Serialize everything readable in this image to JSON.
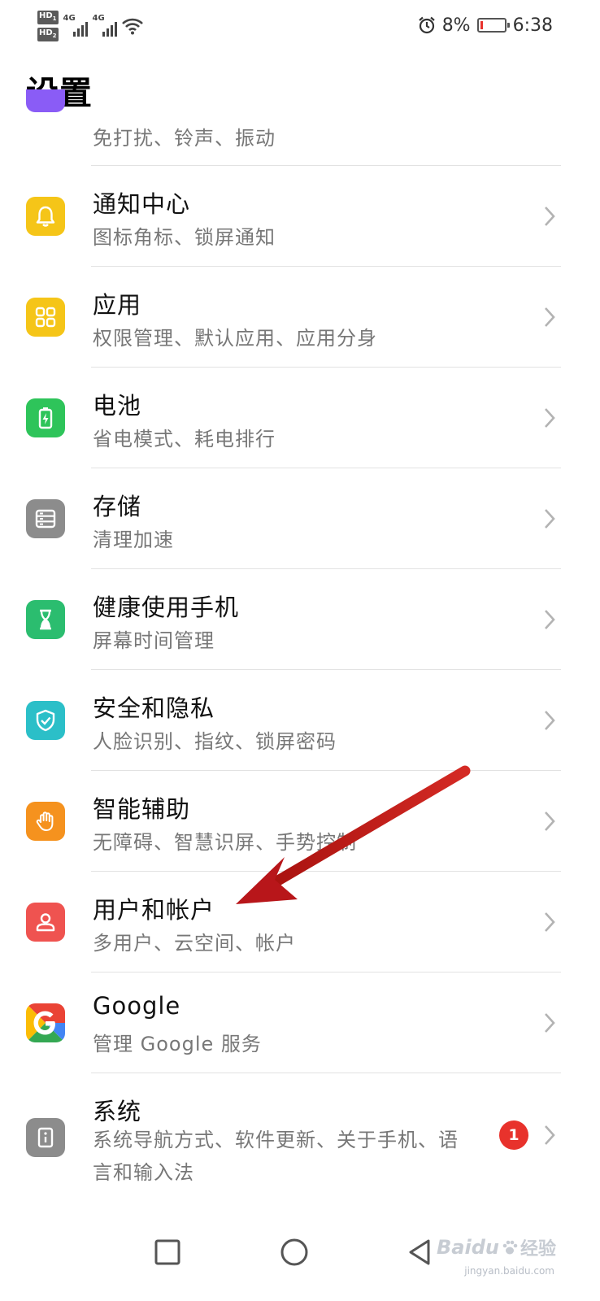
{
  "status_bar": {
    "sim1_tag": "HD",
    "sim1_sub": "1",
    "sim2_tag": "HD",
    "sim2_sub": "2",
    "network1": "4G",
    "network2": "4G",
    "battery_percent": "8%",
    "battery_level": 0.08,
    "time": "6:38",
    "battery_color": "#e8322c"
  },
  "page": {
    "title": "设置"
  },
  "settings": [
    {
      "title": "",
      "subtitle": "免打扰、铃声、振动",
      "icon": "sound-icon",
      "color": "#8a5cf6"
    },
    {
      "title": "通知中心",
      "subtitle": "图标角标、锁屏通知",
      "icon": "bell-icon",
      "color": "#f5c518"
    },
    {
      "title": "应用",
      "subtitle": "权限管理、默认应用、应用分身",
      "icon": "apps-grid-icon",
      "color": "#f5c518"
    },
    {
      "title": "电池",
      "subtitle": "省电模式、耗电排行",
      "icon": "battery-icon",
      "color": "#2ec45a"
    },
    {
      "title": "存储",
      "subtitle": "清理加速",
      "icon": "storage-icon",
      "color": "#8c8c8c"
    },
    {
      "title": "健康使用手机",
      "subtitle": "屏幕时间管理",
      "icon": "hourglass-icon",
      "color": "#2bbd6f"
    },
    {
      "title": "安全和隐私",
      "subtitle": "人脸识别、指纹、锁屏密码",
      "icon": "shield-check-icon",
      "color": "#2bbfc8"
    },
    {
      "title": "智能辅助",
      "subtitle": "无障碍、智慧识屏、手势控制",
      "icon": "hand-icon",
      "color": "#f5921e"
    },
    {
      "title": "用户和帐户",
      "subtitle": "多用户、云空间、帐户",
      "icon": "user-icon",
      "color": "#ef5350"
    },
    {
      "title": "Google",
      "subtitle": "管理 Google 服务",
      "icon": "google-icon",
      "color": "#ffffff"
    },
    {
      "title": "系统",
      "subtitle": "系统导航方式、软件更新、关于手机、语言和输入法",
      "icon": "info-icon",
      "color": "#8c8c8c",
      "badge": "1"
    }
  ],
  "nav_bar": {
    "recents": "square-icon",
    "home": "circle-icon",
    "back": "triangle-back-icon"
  },
  "watermark": {
    "brand": "Baidu",
    "cn": "经验",
    "domain": "jingyan.baidu.com"
  },
  "annotation": {
    "arrow_color": "#c8201e"
  }
}
